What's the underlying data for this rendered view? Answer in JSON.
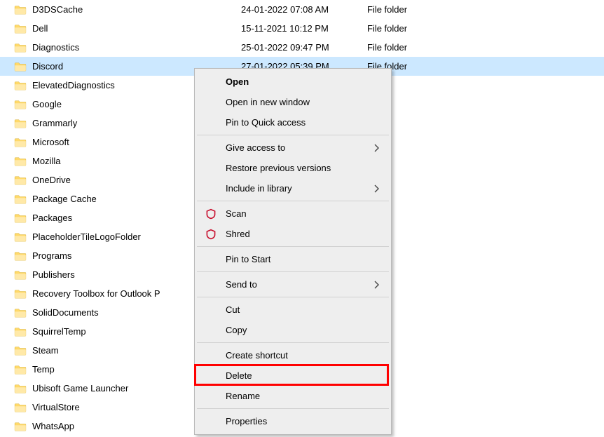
{
  "files": [
    {
      "name": "D3DSCache",
      "date": "24-01-2022 07:08 AM",
      "type": "File folder",
      "selected": false
    },
    {
      "name": "Dell",
      "date": "15-11-2021 10:12 PM",
      "type": "File folder",
      "selected": false
    },
    {
      "name": "Diagnostics",
      "date": "25-01-2022 09:47 PM",
      "type": "File folder",
      "selected": false
    },
    {
      "name": "Discord",
      "date": "27-01-2022 05:39 PM",
      "type": "File folder",
      "selected": true
    },
    {
      "name": "ElevatedDiagnostics",
      "date": "",
      "type": "older",
      "selected": false
    },
    {
      "name": "Google",
      "date": "",
      "type": "older",
      "selected": false
    },
    {
      "name": "Grammarly",
      "date": "",
      "type": "older",
      "selected": false
    },
    {
      "name": "Microsoft",
      "date": "",
      "type": "older",
      "selected": false
    },
    {
      "name": "Mozilla",
      "date": "",
      "type": "older",
      "selected": false
    },
    {
      "name": "OneDrive",
      "date": "",
      "type": "older",
      "selected": false
    },
    {
      "name": "Package Cache",
      "date": "",
      "type": "older",
      "selected": false
    },
    {
      "name": "Packages",
      "date": "",
      "type": "older",
      "selected": false
    },
    {
      "name": "PlaceholderTileLogoFolder",
      "date": "",
      "type": "older",
      "selected": false
    },
    {
      "name": "Programs",
      "date": "",
      "type": "older",
      "selected": false
    },
    {
      "name": "Publishers",
      "date": "",
      "type": "older",
      "selected": false
    },
    {
      "name": "Recovery Toolbox for Outlook P",
      "date": "",
      "type": "older",
      "selected": false
    },
    {
      "name": "SolidDocuments",
      "date": "",
      "type": "older",
      "selected": false
    },
    {
      "name": "SquirrelTemp",
      "date": "",
      "type": "older",
      "selected": false
    },
    {
      "name": "Steam",
      "date": "",
      "type": "older",
      "selected": false
    },
    {
      "name": "Temp",
      "date": "",
      "type": "older",
      "selected": false
    },
    {
      "name": "Ubisoft Game Launcher",
      "date": "",
      "type": "older",
      "selected": false
    },
    {
      "name": "VirtualStore",
      "date": "",
      "type": "older",
      "selected": false
    },
    {
      "name": "WhatsApp",
      "date": "",
      "type": "older",
      "selected": false
    }
  ],
  "context_menu": [
    {
      "kind": "item",
      "label": "Open",
      "bold": true
    },
    {
      "kind": "item",
      "label": "Open in new window"
    },
    {
      "kind": "item",
      "label": "Pin to Quick access"
    },
    {
      "kind": "sep"
    },
    {
      "kind": "item",
      "label": "Give access to",
      "submenu": true
    },
    {
      "kind": "item",
      "label": "Restore previous versions"
    },
    {
      "kind": "item",
      "label": "Include in library",
      "submenu": true
    },
    {
      "kind": "sep"
    },
    {
      "kind": "item",
      "label": "Scan",
      "icon": "mcafee"
    },
    {
      "kind": "item",
      "label": "Shred",
      "icon": "mcafee"
    },
    {
      "kind": "sep"
    },
    {
      "kind": "item",
      "label": "Pin to Start"
    },
    {
      "kind": "sep"
    },
    {
      "kind": "item",
      "label": "Send to",
      "submenu": true
    },
    {
      "kind": "sep"
    },
    {
      "kind": "item",
      "label": "Cut"
    },
    {
      "kind": "item",
      "label": "Copy"
    },
    {
      "kind": "sep"
    },
    {
      "kind": "item",
      "label": "Create shortcut"
    },
    {
      "kind": "item",
      "label": "Delete",
      "highlight": true
    },
    {
      "kind": "item",
      "label": "Rename"
    },
    {
      "kind": "sep"
    },
    {
      "kind": "item",
      "label": "Properties"
    }
  ],
  "colors": {
    "selection": "#cce8ff",
    "menu_bg": "#eeeeee",
    "highlight": "#ff0000"
  }
}
